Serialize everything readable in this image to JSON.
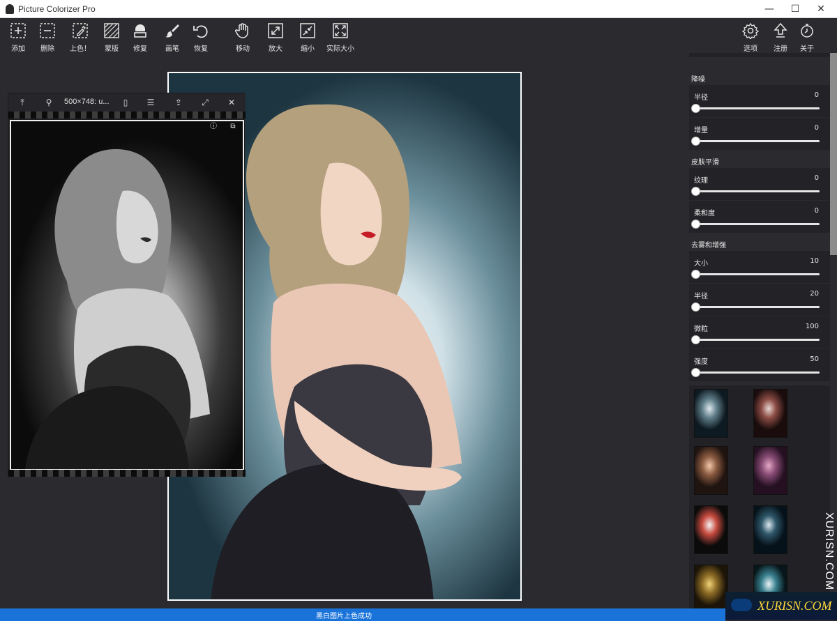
{
  "window": {
    "title": "Picture Colorizer Pro",
    "minimize": "—",
    "maximize": "☐",
    "close": "✕"
  },
  "toolbar": {
    "left": [
      {
        "label": "添加",
        "icon": "add-icon"
      },
      {
        "label": "删除",
        "icon": "remove-icon"
      },
      {
        "label": "上色！",
        "icon": "colorize-icon"
      },
      {
        "label": "蒙版",
        "icon": "mask-icon"
      },
      {
        "label": "修复",
        "icon": "repair-icon"
      },
      {
        "label": "画笔",
        "icon": "brush-icon"
      },
      {
        "label": "恢复",
        "icon": "undo-icon"
      }
    ],
    "view": [
      {
        "label": "移动",
        "icon": "hand-icon"
      },
      {
        "label": "放大",
        "icon": "zoom-in-icon"
      },
      {
        "label": "缩小",
        "icon": "zoom-out-icon"
      },
      {
        "label": "实际大小",
        "icon": "actual-size-icon"
      }
    ],
    "right": [
      {
        "label": "选项",
        "icon": "gear-icon"
      },
      {
        "label": "注册",
        "icon": "register-icon"
      },
      {
        "label": "关于",
        "icon": "about-icon"
      }
    ]
  },
  "preview_window": {
    "title": "500×748: u...",
    "icons": [
      "pin-top-icon",
      "pin-icon",
      "file-icon",
      "list-icon",
      "share-icon",
      "expand-icon",
      "close-icon"
    ],
    "photo_icons": [
      "info-icon",
      "compare-icon"
    ]
  },
  "settings": {
    "sections": [
      {
        "title": "降噪",
        "sliders": [
          {
            "label": "半径",
            "value": "0",
            "level": 0
          },
          {
            "label": "增量",
            "value": "0",
            "level": 0
          }
        ]
      },
      {
        "title": "皮肤平滑",
        "sliders": [
          {
            "label": "纹理",
            "value": "0",
            "level": 0
          },
          {
            "label": "柔和度",
            "value": "0",
            "level": 0
          }
        ]
      },
      {
        "title": "去雾和增强",
        "sliders": [
          {
            "label": "大小",
            "value": "10",
            "level": 0
          },
          {
            "label": "半径",
            "value": "20",
            "level": 0
          },
          {
            "label": "微粒",
            "value": "100",
            "level": 0
          },
          {
            "label": "强度",
            "value": "50",
            "level": 0
          }
        ]
      }
    ]
  },
  "presets": [
    {
      "colors": [
        "#dfe9ee",
        "#5f7d88",
        "#0e1a22"
      ]
    },
    {
      "colors": [
        "#e8d6d0",
        "#8a4b44",
        "#1a0c0c"
      ]
    },
    {
      "colors": [
        "#f1c7a9",
        "#8a5a40",
        "#201410"
      ]
    },
    {
      "colors": [
        "#e3a7c6",
        "#864a73",
        "#241021"
      ]
    },
    {
      "colors": [
        "#f4f4f4",
        "#c64a3e",
        "#0b0b0b"
      ]
    },
    {
      "colors": [
        "#dbe7ee",
        "#2e5668",
        "#06121a"
      ]
    },
    {
      "colors": [
        "#f0d27a",
        "#8b6a24",
        "#1c1408"
      ]
    },
    {
      "colors": [
        "#e9f3f5",
        "#3a8190",
        "#07161a"
      ]
    }
  ],
  "watermark": {
    "vertical": "XURISN.COM",
    "boxed": "XURISN.COM"
  },
  "status": {
    "message": "黑白图片上色成功"
  },
  "colors": {
    "accent": "#1a73d9",
    "background": "#2b2b2f",
    "panel": "#232327"
  }
}
